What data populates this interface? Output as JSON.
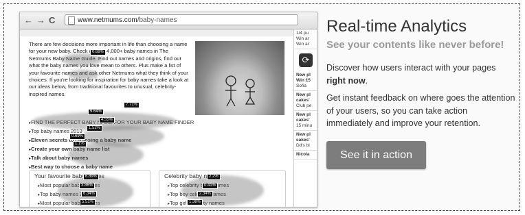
{
  "browser": {
    "back_glyph": "←",
    "forward_glyph": "→",
    "reload_glyph": "C",
    "url_host": "www.netmums.com",
    "url_path": "/baby-names"
  },
  "article": {
    "intro": "There are few decisions more important in life than choosing a name for your new baby. Check out the 4,000+ baby names in The Netmums Baby Name Guide. Find out names and origins, find out what the baby names you love mean to others. Plus make a list of your favourite names and ask other Netmums what they think of your choices. If you're looking for inspiration for baby names take a look at our ideas below, from traditional favourites to unusual, celebrity-inspired names.",
    "links": [
      "FIND THE PERFECT BABY NAME FOR YOUR BABY NAME FINDER",
      "Top baby names 2013",
      "Eleven secrets to choosing a baby name",
      "Create your own baby name list",
      "Talk about baby names",
      "Best way to choose a baby name"
    ],
    "box_left": {
      "title": "Your favourite baby names",
      "items": [
        "Most popular baby names",
        "Top baby names 2013",
        "Most popular baby names"
      ]
    },
    "box_right": {
      "title": "Celebrity baby names",
      "items": [
        "Top celebrity baby names",
        "Top boy celebrity names",
        "Top girl celebrity names"
      ]
    }
  },
  "heat_tags": [
    "0.69%",
    "7.71%",
    "9.64%",
    "4.55%",
    "1.52%",
    "0.69%",
    "1.1%",
    "6.89%",
    "3.86%",
    "6.34%",
    "5.51%",
    "2.2%",
    "0.41%",
    "2.34%",
    "1.38%"
  ],
  "sidebar": {
    "top_lines": [
      "1/4 pu",
      "Win ar",
      "Win ar"
    ],
    "refresh_glyph": "⟳",
    "entries": [
      {
        "title": "New pl Win £5",
        "meta": "Sofia"
      },
      {
        "title": "New pl cakes'",
        "meta": "Club pe"
      },
      {
        "title": "New pl cakes'",
        "meta": "15 minu"
      },
      {
        "title": "New pl cakes'",
        "meta": "Dd's bi"
      },
      {
        "title": "Nicola",
        "meta": ""
      }
    ]
  },
  "promo": {
    "title": "Real-time Analytics",
    "subtitle": "See your contents like never before!",
    "p1_text": "Discover how users interact with your pages ",
    "p1_bold": "right now",
    "p1_end": ".",
    "p2": "Get instant feedback on where goes the attention of your users, so you can take action immediately and improve your retention.",
    "cta_label": "See it in action"
  }
}
